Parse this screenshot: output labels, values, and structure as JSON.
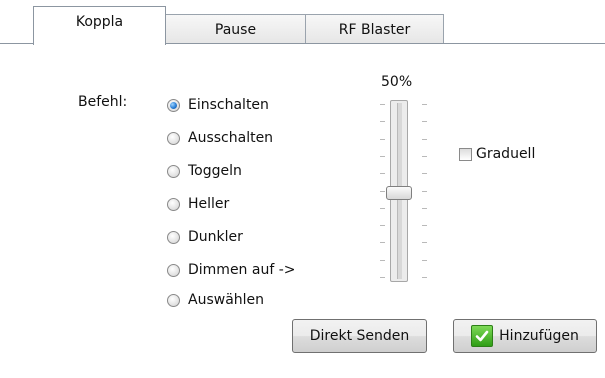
{
  "tabs": [
    {
      "label": "Koppla",
      "active": true
    },
    {
      "label": "Pause",
      "active": false
    },
    {
      "label": "RF Blaster",
      "active": false
    }
  ],
  "command": {
    "label": "Befehl:",
    "selected": "Einschalten",
    "options": [
      "Einschalten",
      "Ausschalten",
      "Toggeln",
      "Heller",
      "Dunkler",
      "Dimmen auf ->",
      "Auswählen"
    ]
  },
  "dimmer": {
    "percent_label": "50%",
    "value_percent": 50
  },
  "gradual": {
    "label": "Graduell",
    "checked": false
  },
  "buttons": {
    "send_label": "Direkt Senden",
    "add_label": "Hinzufügen"
  },
  "colors": {
    "accent_check": "#2f9e16",
    "radio_selected": "#2a7fd6"
  }
}
